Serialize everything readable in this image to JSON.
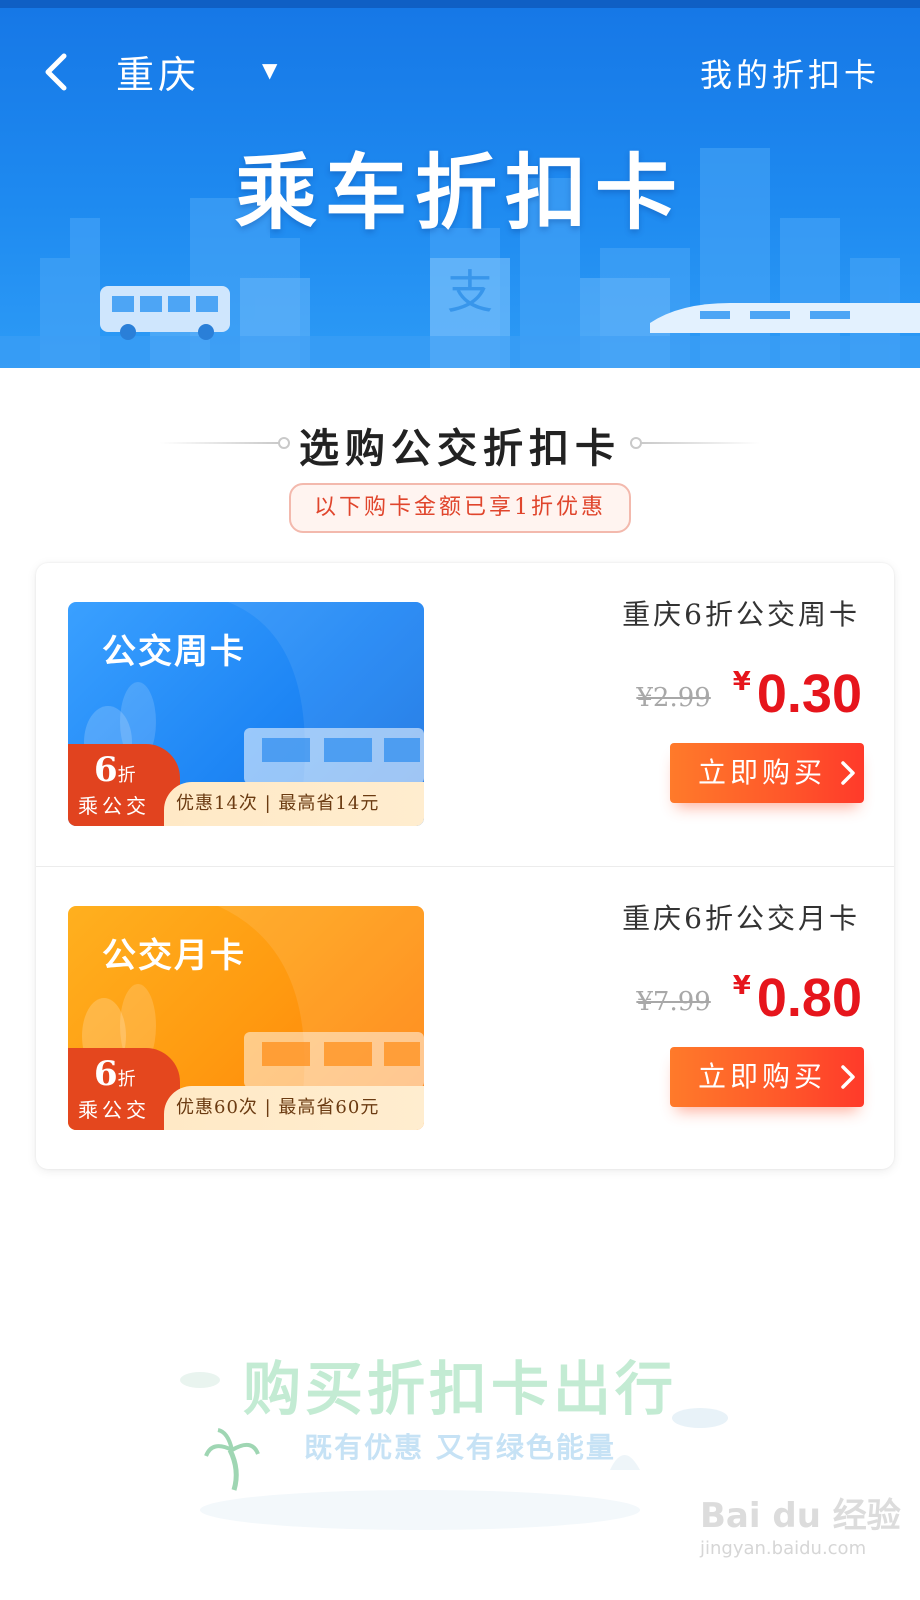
{
  "header": {
    "city": "重庆",
    "my_cards_label": "我的折扣卡",
    "hero_title": "乘车折扣卡",
    "colors": {
      "background": "#1e8af0"
    }
  },
  "section": {
    "title": "选购公交折扣卡",
    "note": "以下购卡金额已享1折优惠"
  },
  "products": [
    {
      "card_name": "公交周卡",
      "badge_pct": "6",
      "badge_unit": "折",
      "badge_sub": "乘公交",
      "strip_text": "优惠14次 | 最高省14元",
      "title": "重庆6折公交周卡",
      "original_price": "¥2.99",
      "currency": "¥",
      "price": "0.30",
      "buy_label": "立即购买",
      "theme_color": "#1e86f5"
    },
    {
      "card_name": "公交月卡",
      "badge_pct": "6",
      "badge_unit": "折",
      "badge_sub": "乘公交",
      "strip_text": "优惠60次 | 最高省60元",
      "title": "重庆6折公交月卡",
      "original_price": "¥7.99",
      "currency": "¥",
      "price": "0.80",
      "buy_label": "立即购买",
      "theme_color": "#ff9a10"
    }
  ],
  "promo": {
    "title": "购买折扣卡出行",
    "subtitle": "既有优惠 又有绿色能量"
  },
  "watermark": {
    "logo": "Bai du 经验",
    "url": "jingyan.baidu.com"
  },
  "colors": {
    "price_red": "#e6151c",
    "button_orange": "#ff5a2a"
  }
}
